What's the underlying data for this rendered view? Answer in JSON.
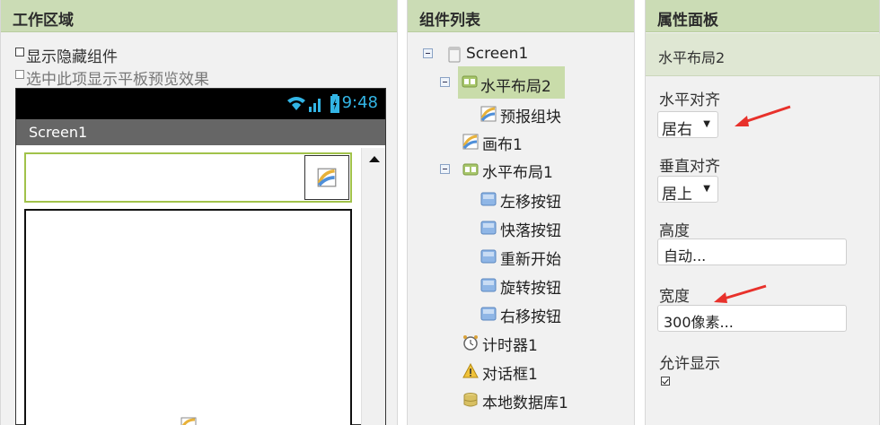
{
  "viewer": {
    "title": "工作区域",
    "show_hidden_label": "显示隐藏组件",
    "tablet_preview_label": "选中此项显示平板预览效果",
    "status_time": "9:48",
    "screen_title": "Screen1"
  },
  "components": {
    "title": "组件列表",
    "tree": [
      {
        "label": "Screen1",
        "icon": "screen-icon"
      },
      {
        "label": "水平布局2",
        "icon": "horizontal-layout-icon"
      },
      {
        "label": "预报组块",
        "icon": "canvas-icon"
      },
      {
        "label": "画布1",
        "icon": "canvas-icon"
      },
      {
        "label": "水平布局1",
        "icon": "horizontal-layout-icon"
      },
      {
        "label": "左移按钮",
        "icon": "button-icon"
      },
      {
        "label": "快落按钮",
        "icon": "button-icon"
      },
      {
        "label": "重新开始",
        "icon": "button-icon"
      },
      {
        "label": "旋转按钮",
        "icon": "button-icon"
      },
      {
        "label": "右移按钮",
        "icon": "button-icon"
      },
      {
        "label": "计时器1",
        "icon": "clock-icon"
      },
      {
        "label": "对话框1",
        "icon": "notifier-icon"
      },
      {
        "label": "本地数据库1",
        "icon": "database-icon"
      }
    ]
  },
  "properties": {
    "title": "属性面板",
    "component_name": "水平布局2",
    "align_horizontal_label": "水平对齐",
    "align_horizontal_value": "居右",
    "align_vertical_label": "垂直对齐",
    "align_vertical_value": "居上",
    "height_label": "高度",
    "height_value": "自动...",
    "width_label": "宽度",
    "width_value": "300像素...",
    "visible_label": "允许显示"
  },
  "colors": {
    "header_bg": "#cbdcb5",
    "selected_bg": "#c9dcaa",
    "status_accent": "#33b5e5",
    "annotation_arrow": "#e8312b"
  }
}
